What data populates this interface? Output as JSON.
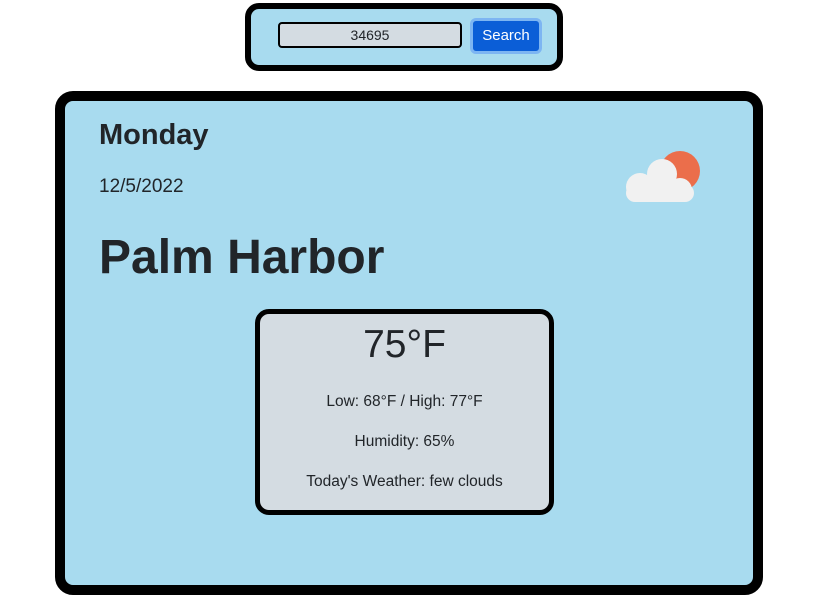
{
  "search": {
    "value": "34695",
    "button_label": "Search"
  },
  "weather": {
    "day": "Monday",
    "date": "12/5/2022",
    "city": "Palm Harbor",
    "icon": "few-clouds-icon",
    "temperature": "75°F",
    "low_high": "Low: 68°F / High: 77°F",
    "humidity": "Humidity: 65%",
    "description": "Today's Weather: few clouds"
  },
  "colors": {
    "panel_background": "#a8dbef",
    "details_background": "#d4dce2",
    "button_primary": "#0b5ed7",
    "sun": "#eb6e4b",
    "cloud": "#f1f1f1"
  }
}
